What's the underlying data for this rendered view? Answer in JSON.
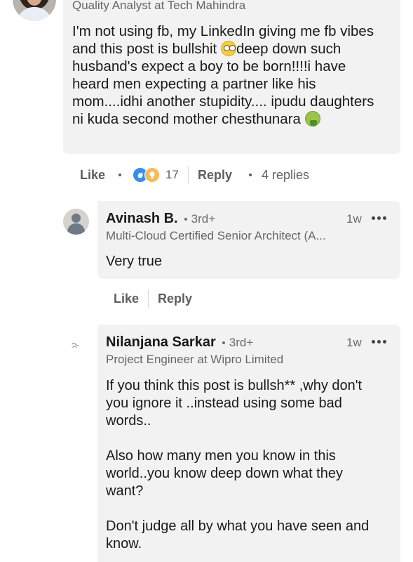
{
  "top_comment": {
    "headline": "Quality Analyst at Tech Mahindra",
    "text_parts": [
      "I'm not using fb, my LinkedIn giving me fb vibes\nand this post is bullshit ",
      "deep down such\nhusband's expect a  boy to be born!!!!i have\nheard men expecting a  partner like his\nmom....idhi another stupidity.... ipudu daughters\nni kuda second mother chesthunara "
    ],
    "emojis": [
      "face-with-rolling-eyes",
      "face-vomiting"
    ],
    "actions": {
      "like_label": "Like",
      "reaction_count": "17",
      "reaction_icons": [
        "clap-icon",
        "lightbulb-icon"
      ],
      "reply_label": "Reply",
      "replies_label": "4 replies"
    }
  },
  "replies": [
    {
      "name": "Avinash B.",
      "degree": "3rd+",
      "time": "1w",
      "headline": "Multi-Cloud Certified Senior Architect (A...",
      "text": "Very true",
      "like_label": "Like",
      "reply_label": "Reply"
    },
    {
      "name": "Nilanjana Sarkar",
      "degree": "3rd+",
      "time": "1w",
      "headline": "Project Engineer at Wipro Limited",
      "text": "If you think this post is bullsh** ,why don't\nyou ignore it ..instead using some bad\nwords..\n\nAlso how many men you know in this\nworld..you know deep down what they\nwant?\n\nDon't judge all by what you have seen and\nknow."
    }
  ],
  "colors": {
    "bubble": "#f2f2f2",
    "text": "#1a1a1a",
    "muted": "#666666",
    "clap_blue": "#378fe9",
    "idea_yellow": "#f5bb5c"
  }
}
